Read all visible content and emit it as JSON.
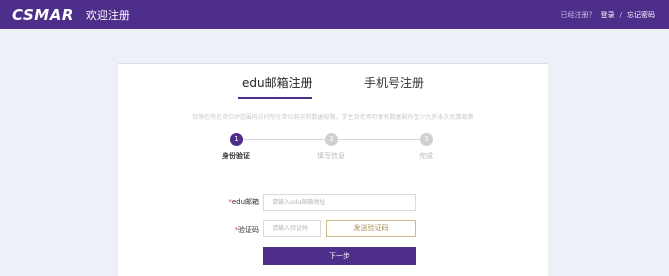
{
  "header": {
    "logo": "CSMAR",
    "title": "欢迎注册",
    "already_registered": "已经注册？",
    "login": "登录",
    "separator": "/",
    "forgot_password": "忘记密码"
  },
  "tabs": [
    {
      "label": "edu邮箱注册",
      "active": true
    },
    {
      "label": "手机号注册",
      "active": false
    }
  ],
  "notice": "仅限在所在单位IP范围内访问所在单位购买的数据权限，学生及老师可享有数据副作至少九折永久优惠政策",
  "steps": [
    {
      "number": "1",
      "label": "身份验证",
      "active": true
    },
    {
      "number": "2",
      "label": "填写信息",
      "active": false
    },
    {
      "number": "3",
      "label": "完成",
      "active": false
    }
  ],
  "form": {
    "email_label": "edu邮箱",
    "email_placeholder": "请输入edu邮箱地址",
    "code_label": "验证码",
    "code_placeholder": "请输入验证码",
    "required_mark": "*",
    "send_code": "发送验证码",
    "next": "下一步"
  },
  "colors": {
    "brand": "#4d2e8b",
    "send_button_text": "#a8905a",
    "required": "#e53b3b"
  }
}
